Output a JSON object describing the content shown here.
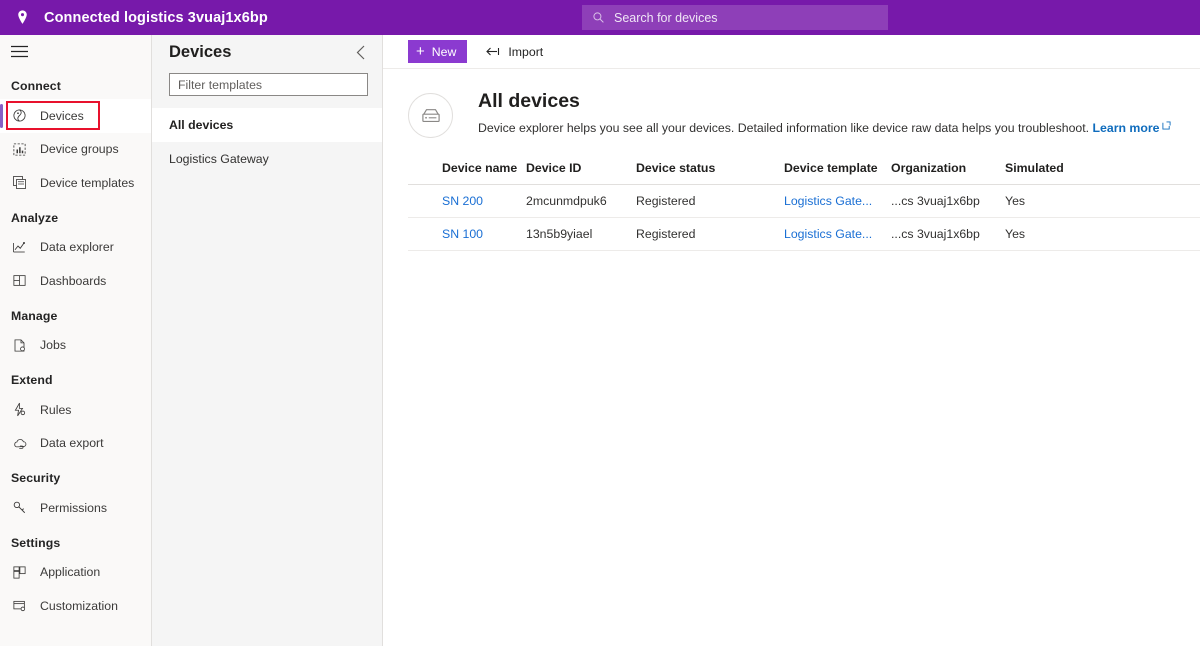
{
  "topbar": {
    "logo_icon": "location-pin-icon",
    "title": "Connected logistics 3vuaj1x6bp",
    "search_placeholder": "Search for devices",
    "search_icon": "search-icon",
    "brand_color": "#7719aa"
  },
  "sidebar": {
    "menu_icon": "hamburger-menu-icon",
    "sections": [
      {
        "label": "Connect",
        "items": [
          {
            "label": "Devices",
            "icon": "devices-icon",
            "selected": true,
            "highlighted": true
          },
          {
            "label": "Device groups",
            "icon": "device-groups-icon",
            "selected": false,
            "highlighted": false
          },
          {
            "label": "Device templates",
            "icon": "device-templates-icon",
            "selected": false,
            "highlighted": false
          }
        ]
      },
      {
        "label": "Analyze",
        "items": [
          {
            "label": "Data explorer",
            "icon": "data-explorer-icon",
            "selected": false,
            "highlighted": false
          },
          {
            "label": "Dashboards",
            "icon": "dashboards-icon",
            "selected": false,
            "highlighted": false
          }
        ]
      },
      {
        "label": "Manage",
        "items": [
          {
            "label": "Jobs",
            "icon": "jobs-icon",
            "selected": false,
            "highlighted": false
          }
        ]
      },
      {
        "label": "Extend",
        "items": [
          {
            "label": "Rules",
            "icon": "rules-icon",
            "selected": false,
            "highlighted": false
          },
          {
            "label": "Data export",
            "icon": "data-export-icon",
            "selected": false,
            "highlighted": false
          }
        ]
      },
      {
        "label": "Security",
        "items": [
          {
            "label": "Permissions",
            "icon": "permissions-key-icon",
            "selected": false,
            "highlighted": false
          }
        ]
      },
      {
        "label": "Settings",
        "items": [
          {
            "label": "Application",
            "icon": "application-icon",
            "selected": false,
            "highlighted": false
          },
          {
            "label": "Customization",
            "icon": "customization-icon",
            "selected": false,
            "highlighted": false
          }
        ]
      }
    ],
    "highlight_color": "#e8112d",
    "selected_indicator_color": "#8661c5"
  },
  "templates_panel": {
    "title": "Devices",
    "collapse_icon": "chevron-left-icon",
    "filter_placeholder": "Filter templates",
    "filter_value": "",
    "items": [
      {
        "label": "All devices",
        "selected": true
      },
      {
        "label": "Logistics Gateway",
        "selected": false
      }
    ]
  },
  "toolbar": {
    "new_label": "New",
    "new_icon": "plus-icon",
    "import_label": "Import",
    "import_icon": "import-arrow-icon",
    "new_button_color": "#8b3ad0"
  },
  "page_header": {
    "icon": "device-box-icon",
    "title": "All devices",
    "description": "Device explorer helps you see all your devices. Detailed information like device raw data helps you troubleshoot.",
    "learn_more_label": "Learn more",
    "learn_more_icon": "external-link-icon",
    "link_color": "#0f6cbd"
  },
  "table": {
    "columns": [
      "Device name",
      "Device ID",
      "Device status",
      "Device template",
      "Organization",
      "Simulated"
    ],
    "rows": [
      {
        "device_name": "SN 200",
        "device_id": "2mcunmdpuk6",
        "device_status": "Registered",
        "device_template": "Logistics Gate...",
        "organization": "...cs 3vuaj1x6bp",
        "simulated": "Yes"
      },
      {
        "device_name": "SN 100",
        "device_id": "13n5b9yiael",
        "device_status": "Registered",
        "device_template": "Logistics Gate...",
        "organization": "...cs 3vuaj1x6bp",
        "simulated": "Yes"
      }
    ],
    "link_color": "#1a6fd4"
  }
}
